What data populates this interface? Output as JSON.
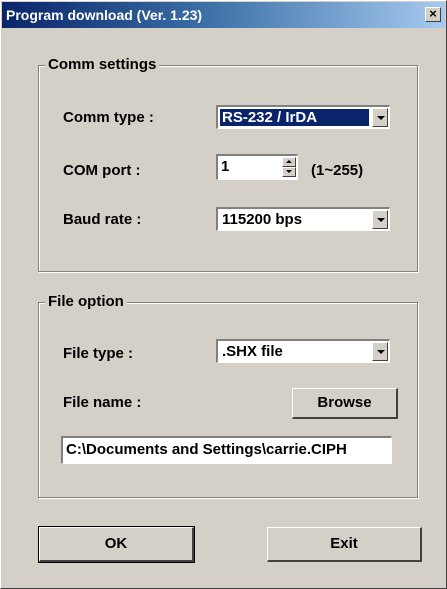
{
  "window": {
    "title": "Program download  (Ver. 1.23)",
    "close_label": "×"
  },
  "comm_settings": {
    "legend": "Comm settings",
    "comm_type_label": "Comm type :",
    "comm_type_value": "RS-232 / IrDA",
    "com_port_label": "COM port :",
    "com_port_value": "1",
    "com_port_range": "(1~255)",
    "baud_rate_label": "Baud rate :",
    "baud_rate_value": "115200 bps"
  },
  "file_option": {
    "legend": "File option",
    "file_type_label": "File type :",
    "file_type_value": ".SHX file",
    "file_name_label": "File name :",
    "browse_label": "Browse",
    "file_path_value": "C:\\Documents and Settings\\carrie.CIPH"
  },
  "buttons": {
    "ok_label": "OK",
    "exit_label": "Exit"
  },
  "colors": {
    "title_bar": "#0a246a",
    "dialog_bg": "#d4d0c8",
    "selection": "#0a246a"
  }
}
